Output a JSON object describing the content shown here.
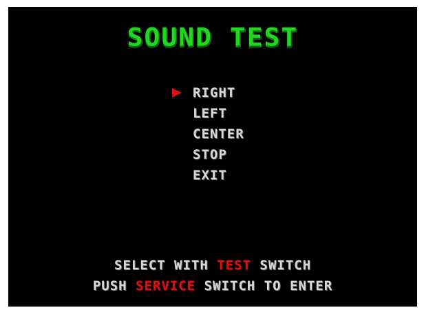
{
  "title": "SOUND TEST",
  "menu": {
    "selected_index": 0,
    "items": [
      {
        "label": "RIGHT"
      },
      {
        "label": "LEFT"
      },
      {
        "label": "CENTER"
      },
      {
        "label": "STOP"
      },
      {
        "label": "EXIT"
      }
    ]
  },
  "footer": {
    "line1": {
      "before": "SELECT WITH ",
      "highlight": "TEST",
      "after": " SWITCH"
    },
    "line2": {
      "before": "PUSH ",
      "highlight": "SERVICE",
      "after": " SWITCH TO ENTER"
    }
  },
  "colors": {
    "background": "#000000",
    "title": "#22d622",
    "text": "#d8d8d8",
    "highlight": "#e01010"
  }
}
